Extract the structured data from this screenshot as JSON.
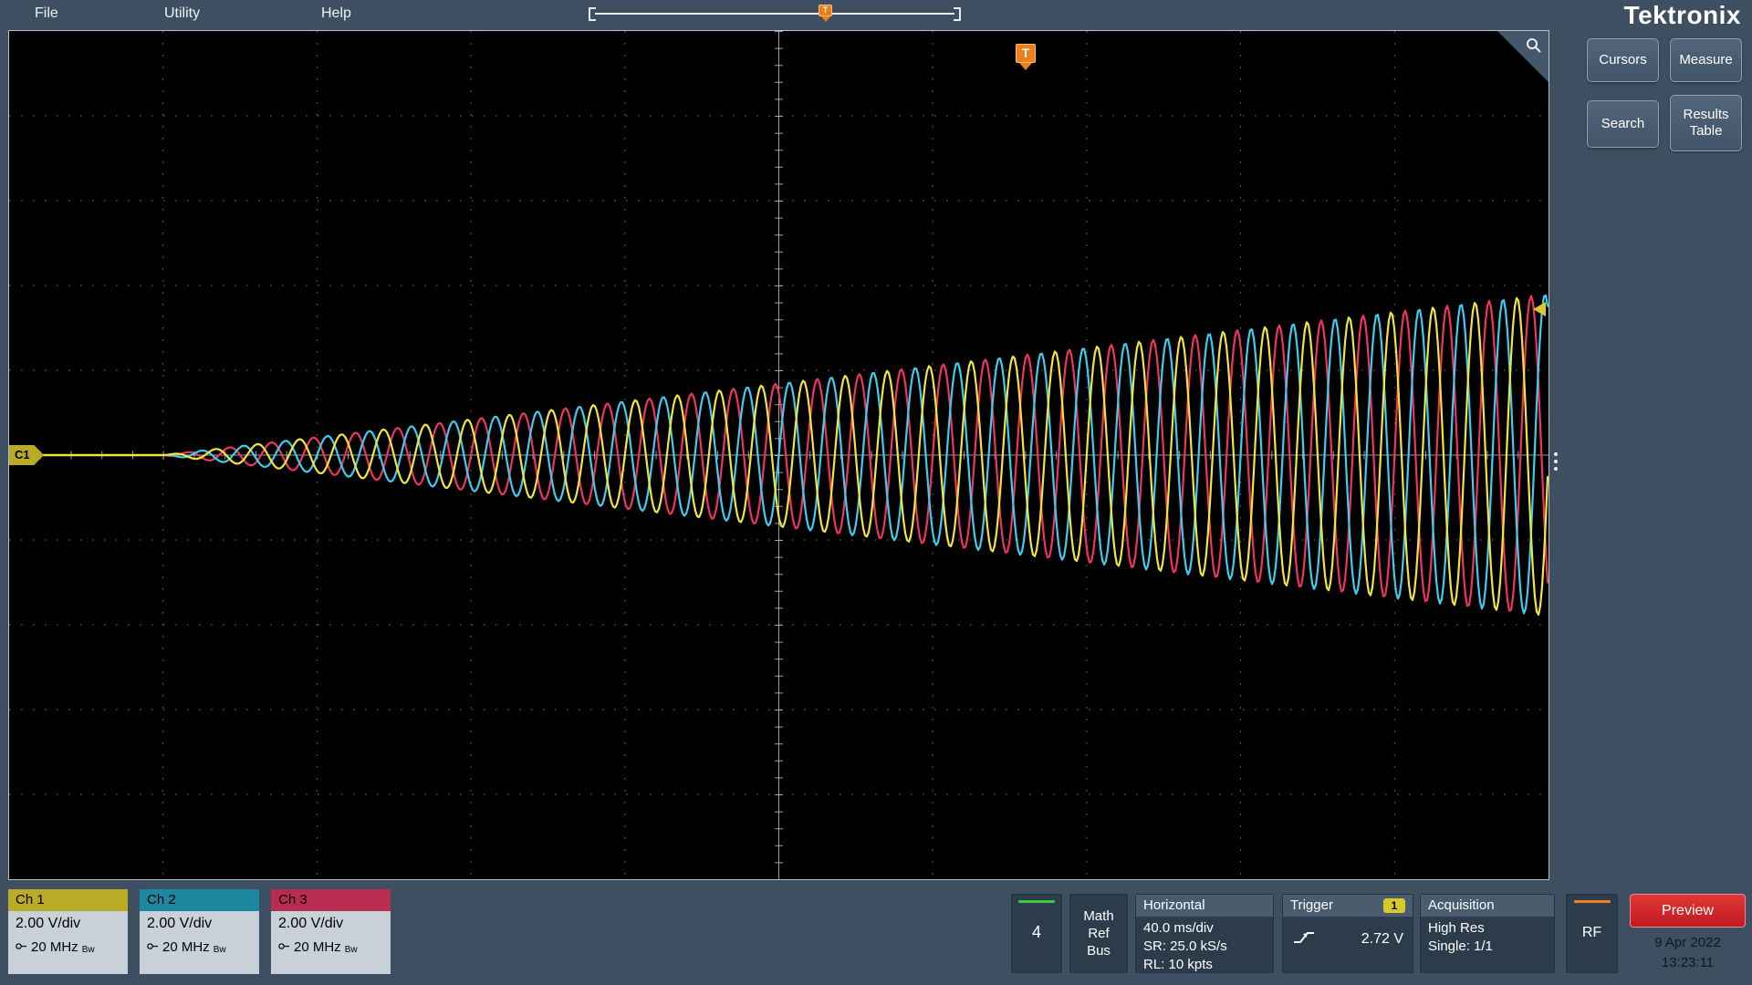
{
  "menu": {
    "items": [
      "File",
      "Utility",
      "Help"
    ]
  },
  "record_view": {
    "trigger_marker": "T"
  },
  "logo_text": "Tektronix",
  "sidebar": {
    "buttons": [
      "Cursors",
      "Measure",
      "Search",
      "Results Table"
    ]
  },
  "screen": {
    "channel_ref_label": "C1",
    "trigger_flag": "T"
  },
  "labels": {
    "bw": "Bw"
  },
  "channels": [
    {
      "name": "Ch 1",
      "scale": "2.00 V/div",
      "bandwidth": "20 MHz",
      "color": "#b9ab25"
    },
    {
      "name": "Ch 2",
      "scale": "2.00 V/div",
      "bandwidth": "20 MHz",
      "color": "#1e87a0"
    },
    {
      "name": "Ch 3",
      "scale": "2.00 V/div",
      "bandwidth": "20 MHz",
      "color": "#b72c4f"
    }
  ],
  "channel4": {
    "label": "4",
    "indicator_color": "#3fc93f"
  },
  "math_ref_bus": {
    "lines": [
      "Math",
      "Ref",
      "Bus"
    ]
  },
  "horizontal": {
    "title": "Horizontal",
    "scale": "40.0 ms/div",
    "sample_rate": "SR: 25.0 kS/s",
    "record_length": "RL: 10 kpts"
  },
  "trigger": {
    "title": "Trigger",
    "source": "1",
    "level": "2.72 V"
  },
  "acquisition": {
    "title": "Acquisition",
    "mode": "High Res",
    "sequence": "Single: 1/1"
  },
  "rf": {
    "label": "RF",
    "indicator_color": "#f0801e"
  },
  "preview": {
    "label": "Preview",
    "date": "9 Apr 2022",
    "time": "13:23:11"
  },
  "chart_data": {
    "type": "line",
    "title": "Oscilloscope graticule with three amplitude-ramping sine traces",
    "x_axis": {
      "scale": "40.0 ms/div",
      "divisions": 10
    },
    "y_axis": {
      "scale": "2.00 V/div",
      "divisions": 10
    },
    "description": "Ch1 (yellow), Ch2 (cyan) and Ch3 (red) sine waves, mutually phase shifted 120 deg, amplitude growing linearly from 0 near the record start to about 1.9 divisions (~3.7 V peak) at the right edge; roughly 33 cycles across the record",
    "cycles": 33,
    "start_x_frac": 0.1,
    "end_amplitude_frac": 0.19,
    "series": [
      {
        "name": "Ch 3",
        "color": "#ee3460",
        "phase_deg": 240
      },
      {
        "name": "Ch 2",
        "color": "#3ecdee",
        "phase_deg": 120
      },
      {
        "name": "Ch 1",
        "color": "#f2e63c",
        "phase_deg": 0
      }
    ]
  }
}
